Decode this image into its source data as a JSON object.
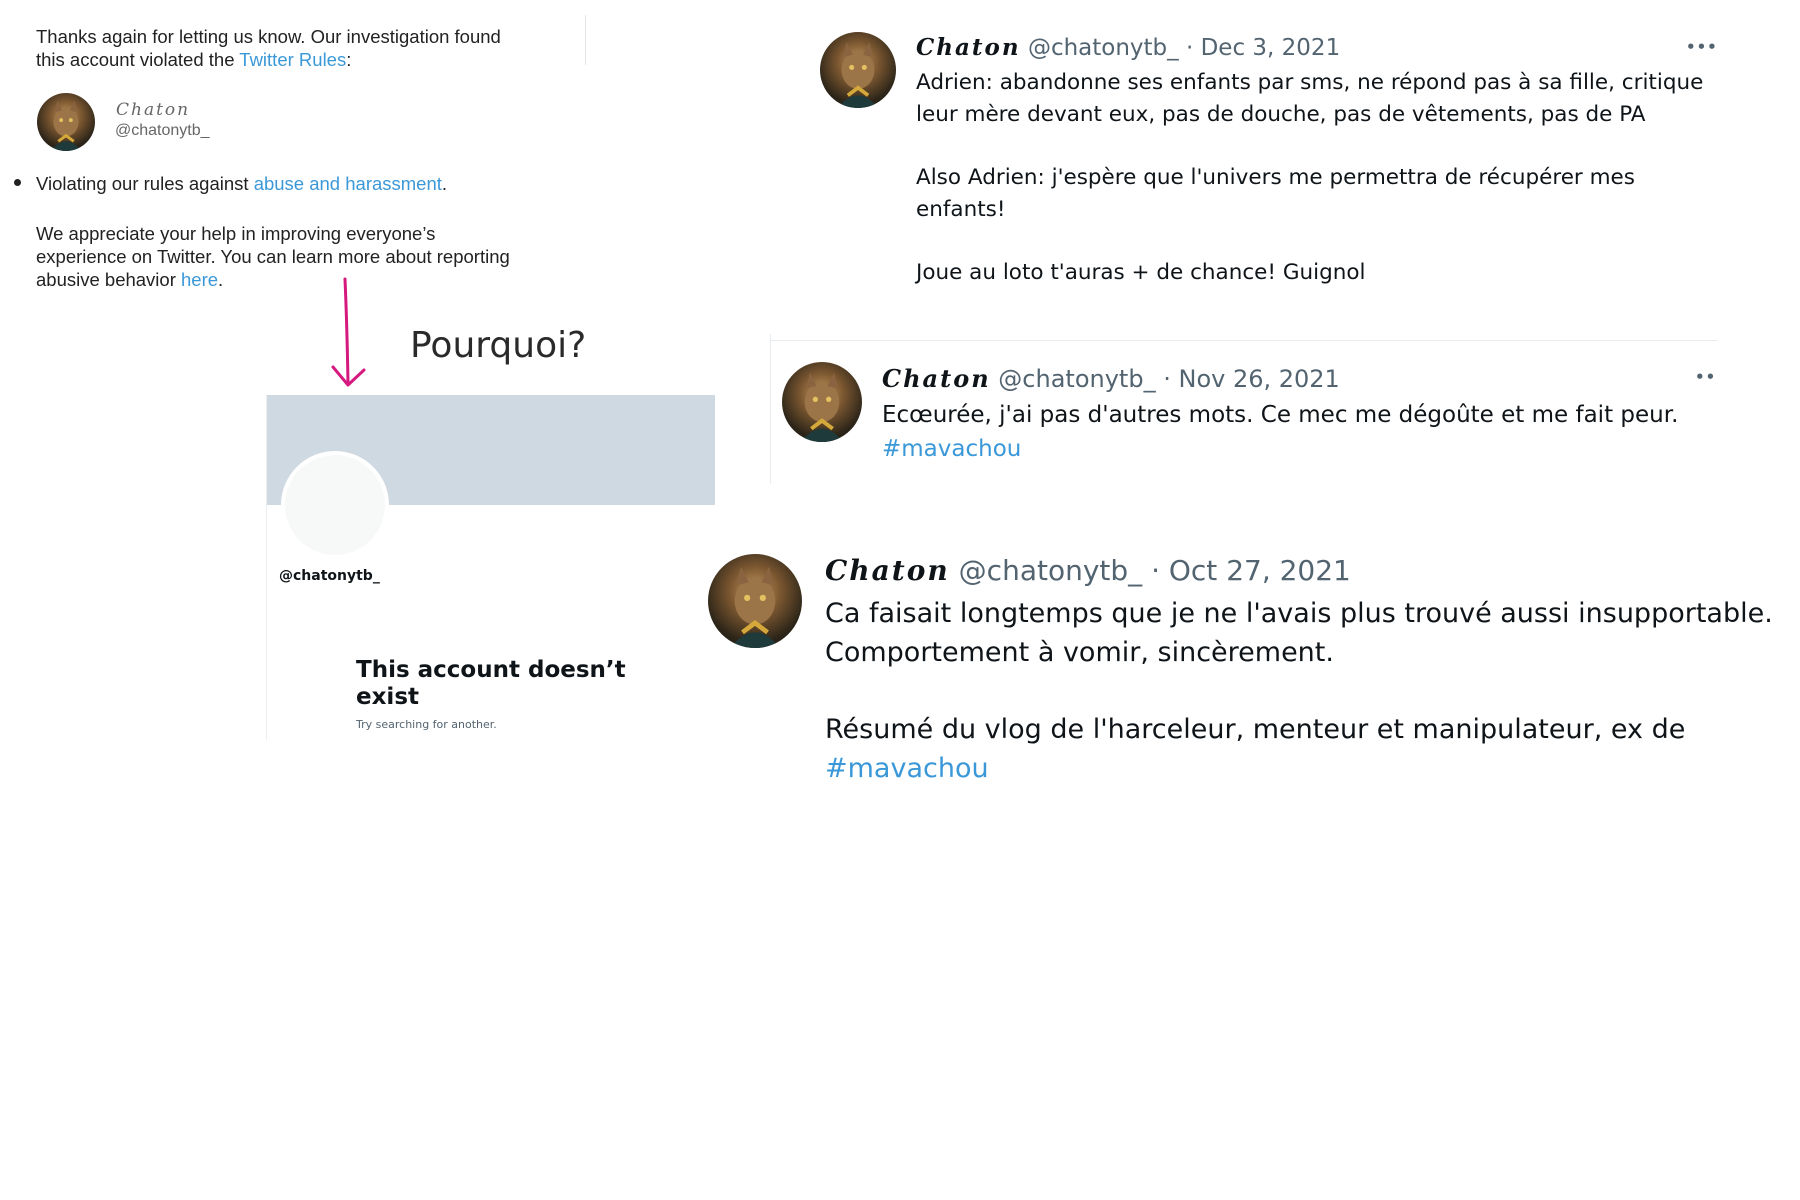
{
  "email": {
    "line1": "Thanks again for letting us know. Our investigation found",
    "line2_prefix": "this account violated the ",
    "line2_link": "Twitter Rules",
    "line2_suffix": ":",
    "account_name": "Chaton",
    "account_handle": "@chatonytb_",
    "bullet_prefix": "Violating our rules against ",
    "bullet_link": "abuse and harassment",
    "bullet_suffix": ".",
    "para2_line1": "We appreciate your help in improving everyone’s",
    "para2_line2": "experience on Twitter. You can learn more about reporting",
    "para2_line3_prefix": "abusive behavior ",
    "para2_line3_link": "here",
    "para2_line3_suffix": "."
  },
  "annotation": {
    "question": "Pourquoi?",
    "arrow_color": "#d6197f"
  },
  "profile": {
    "handle": "@chatonytb_",
    "title_line1": "This account doesn’t",
    "title_line2": "exist",
    "subtitle": "Try searching for another."
  },
  "tweets": [
    {
      "name": "Chaton",
      "handle": "@chatonytb_",
      "separator": "·",
      "date": "Dec 3, 2021",
      "more": "•••",
      "line1": "Adrien: abandonne ses enfants par sms, ne répond pas à sa fille, critique",
      "line2": "leur mère devant eux, pas de douche, pas de vêtements, pas de PA",
      "line3": "Also Adrien: j'espère que l'univers me permettra de récupérer mes",
      "line4": "enfants!",
      "line5": "Joue au loto t'auras + de chance! Guignol"
    },
    {
      "name": "Chaton",
      "handle": "@chatonytb_",
      "separator": "·",
      "date": "Nov 26, 2021",
      "more": "••",
      "line1": "Ecœurée, j'ai pas d'autres mots. Ce mec me dégoûte et me fait peur.",
      "hashtag": "#mavachou"
    },
    {
      "name": "Chaton",
      "handle": "@chatonytb_",
      "separator": "·",
      "date": "Oct 27, 2021",
      "line1": "Ca faisait longtemps que je ne l'avais plus trouvé aussi insupportable.",
      "line2": "Comportement à vomir, sincèrement.",
      "line3": "Résumé du vlog de l'harceleur, menteur et manipulateur, ex de",
      "hashtag": "#mavachou"
    }
  ],
  "colors": {
    "link": "#3a98d8",
    "banner": "#cfd9e1",
    "muted": "#536471"
  }
}
